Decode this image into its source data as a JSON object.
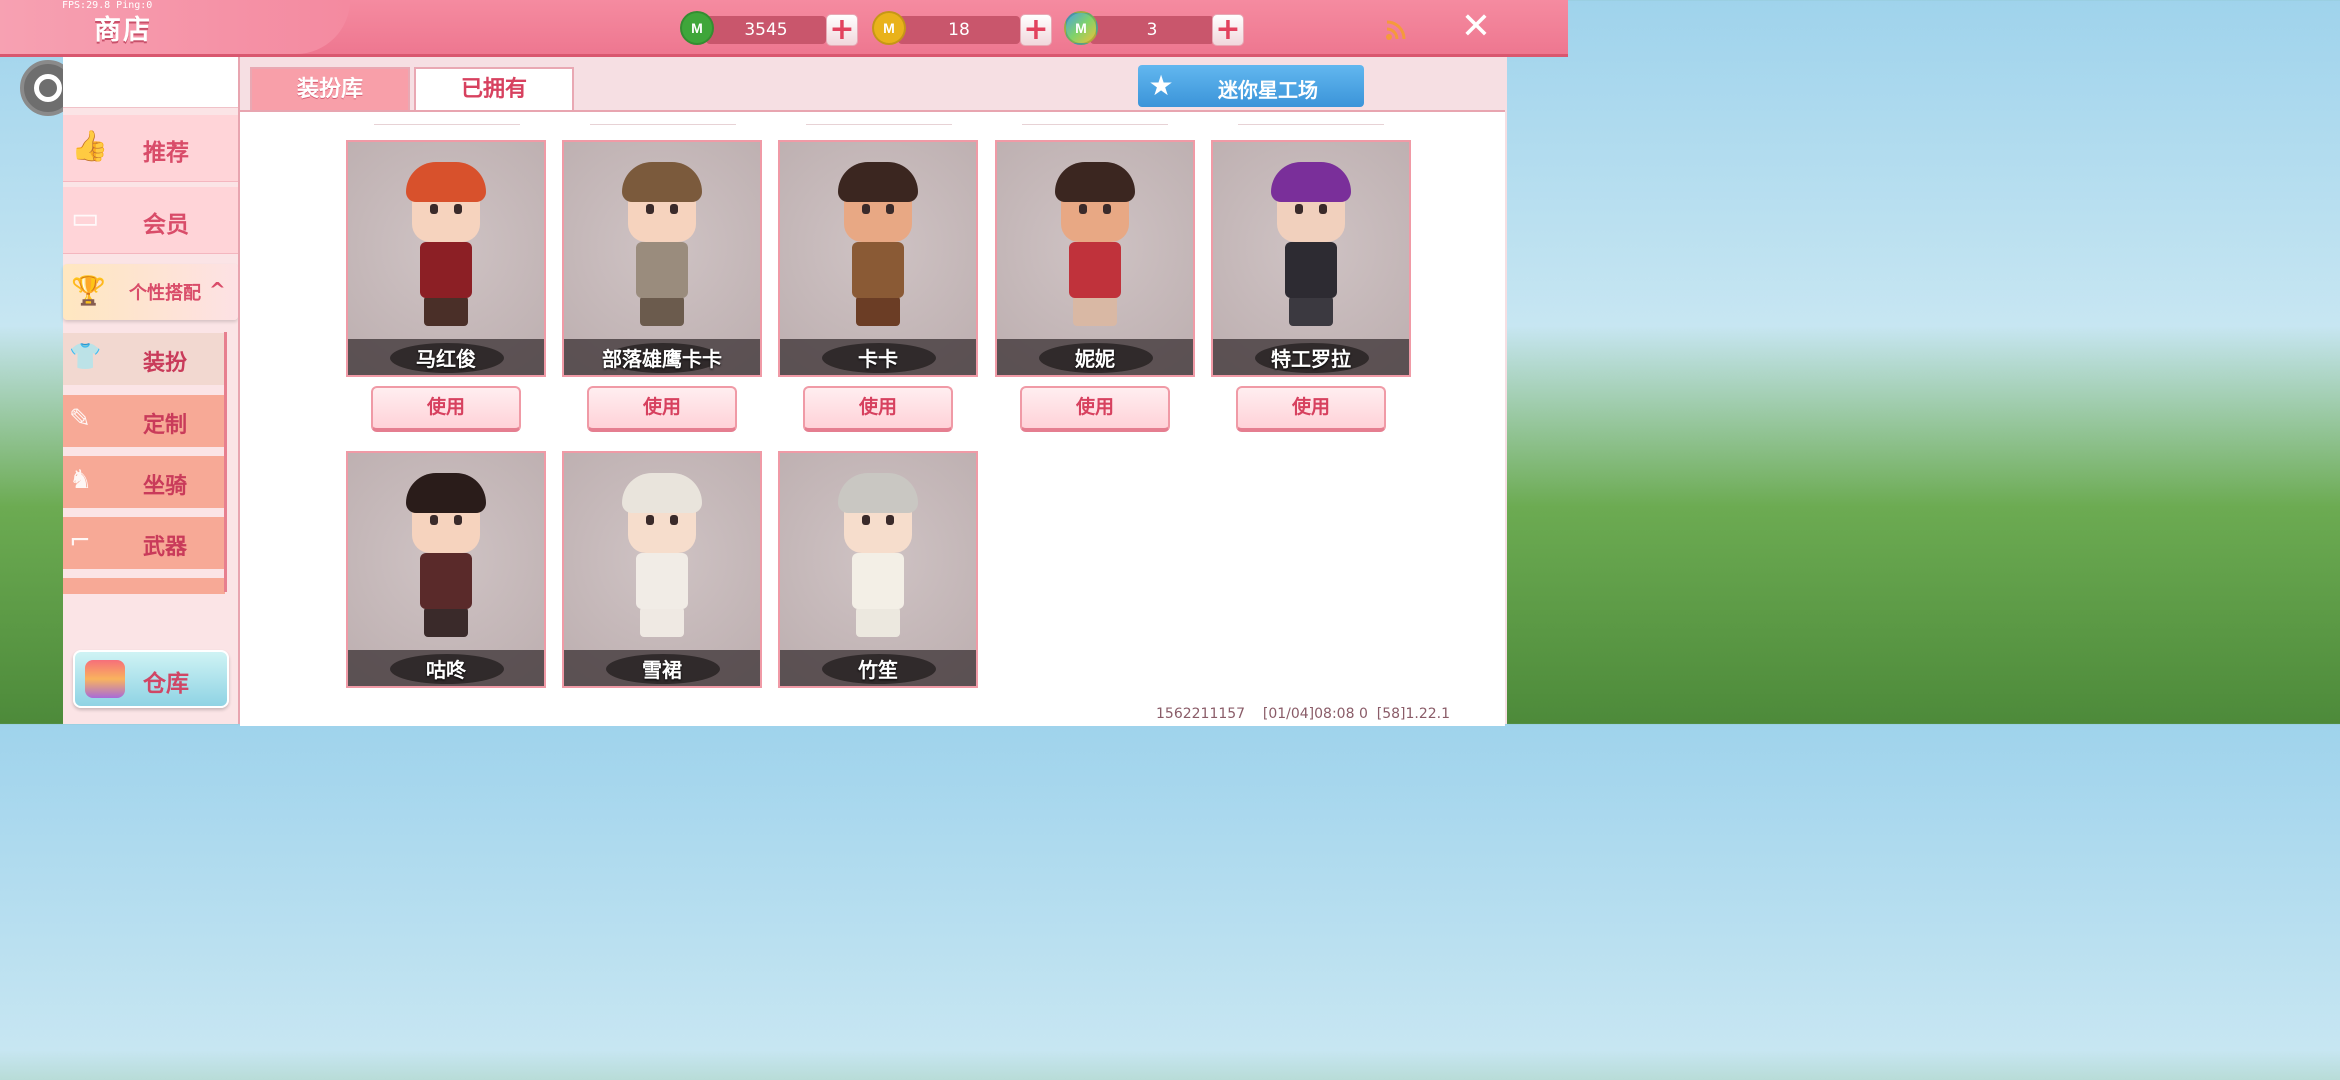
{
  "status": {
    "fps_text": "FPS:29.8 Ping:0"
  },
  "header": {
    "title": "商店",
    "currencies": [
      {
        "icon": "green-gem-coin-icon",
        "letter": "M",
        "value": "3545",
        "color": "#3fa63a"
      },
      {
        "icon": "gold-coin-icon",
        "letter": "M",
        "value": "18",
        "color": "#e9b21a"
      },
      {
        "icon": "rainbow-coin-icon",
        "letter": "M",
        "value": "3",
        "color": "#4aa0e0"
      }
    ],
    "plus_symbol": "+",
    "close_symbol": "✕"
  },
  "sidebar": {
    "nav": [
      {
        "label": "推荐",
        "icon": "thumbs-up-icon"
      },
      {
        "label": "会员",
        "icon": "member-card-icon"
      }
    ],
    "custom": {
      "label": "个性搭配",
      "chevron": "^"
    },
    "sub": [
      {
        "label": "装扮",
        "icon": "shirt-icon",
        "active": true
      },
      {
        "label": "定制",
        "icon": "brush-icon"
      },
      {
        "label": "坐骑",
        "icon": "saddle-icon"
      },
      {
        "label": "武器",
        "icon": "gun-icon"
      }
    ],
    "warehouse": {
      "label": "仓库",
      "icon": "chest-icon"
    }
  },
  "tabs": [
    {
      "label": "装扮库",
      "active": false
    },
    {
      "label": "已拥有",
      "active": true
    }
  ],
  "workshop": {
    "label": "迷你星工场",
    "icon": "star-icon"
  },
  "skins": [
    {
      "name": "马红俊",
      "use_label": "使用",
      "hair": "#d8512c",
      "outfit": "#8c1f25",
      "legs": "#4a2f28",
      "skin": "#f6d3be"
    },
    {
      "name": "部落雄鹰卡卡",
      "use_label": "使用",
      "hair": "#7b5a3c",
      "outfit": "#9a8c7d",
      "legs": "#6b5b4d",
      "skin": "#f6d3be"
    },
    {
      "name": "卡卡",
      "use_label": "使用",
      "hair": "#3b2620",
      "outfit": "#8a5a35",
      "legs": "#6b3d25",
      "skin": "#e8a884"
    },
    {
      "name": "妮妮",
      "use_label": "使用",
      "hair": "#3b2620",
      "outfit": "#c0323b",
      "legs": "#d9b8a4",
      "skin": "#e8a884"
    },
    {
      "name": "特工罗拉",
      "use_label": "使用",
      "hair": "#7a2f9a",
      "outfit": "#2d2b32",
      "legs": "#3b3940",
      "skin": "#f1d0bd"
    },
    {
      "name": "咕咚",
      "use_label": null,
      "hair": "#2a1c1a",
      "outfit": "#5a2a2a",
      "legs": "#3a2a2a",
      "skin": "#f6d3be"
    },
    {
      "name": "雪裙",
      "use_label": null,
      "hair": "#e9e4dc",
      "outfit": "#f1ece6",
      "legs": "#efe9e3",
      "skin": "#f6ddcc"
    },
    {
      "name": "竹笙",
      "use_label": null,
      "hair": "#c9c7c2",
      "outfit": "#f3efe6",
      "legs": "#ece8df",
      "skin": "#f6ddcc"
    }
  ],
  "footer": {
    "text": "1562211157    [01/04]08:08 0  [58]1.22.1"
  }
}
